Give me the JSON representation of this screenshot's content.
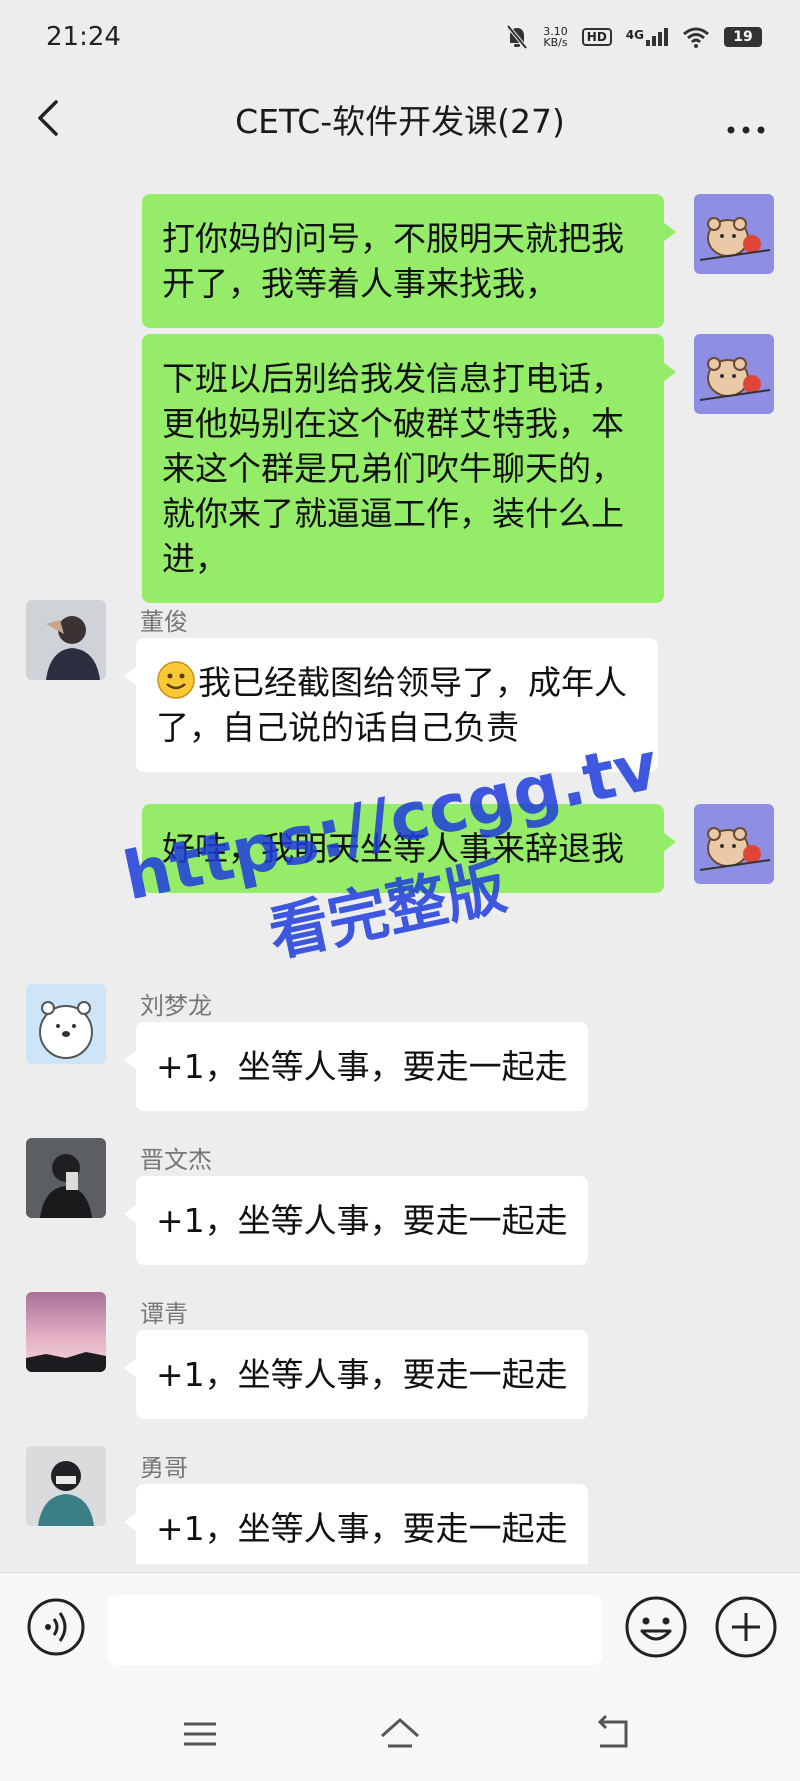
{
  "status_bar": {
    "time": "21:24",
    "net_speed_value": "3.10",
    "net_speed_unit": "KB/s",
    "hd_label": "HD",
    "network_label": "4G",
    "battery": "19"
  },
  "header": {
    "title": "CETC-软件开发课(27)"
  },
  "messages": [
    {
      "side": "right",
      "text": "打你妈的问号，不服明天就把我开了，我等着人事来找我，",
      "avatar": "bear-avatar"
    },
    {
      "side": "right",
      "text": "下班以后别给我发信息打电话，更他妈别在这个破群艾特我，本来这个群是兄弟们吹牛聊天的，就你来了就逼逼工作，装什么上进，",
      "avatar": "bear-avatar"
    },
    {
      "side": "left",
      "sender": "董俊",
      "text": "我已经截图给领导了，成年人了，自己说的话自己负责",
      "emoji": "smiley"
    },
    {
      "side": "right",
      "text": "好哇，我明天坐等人事来辞退我",
      "avatar": "bear-avatar"
    },
    {
      "side": "left",
      "sender": "刘梦龙",
      "text": "+1，坐等人事，要走一起走"
    },
    {
      "side": "left",
      "sender": "晋文杰",
      "text": "+1，坐等人事，要走一起走"
    },
    {
      "side": "left",
      "sender": "谭青",
      "text": "+1，坐等人事，要走一起走"
    },
    {
      "side": "left",
      "sender": "勇哥",
      "text": "+1，坐等人事，要走一起走"
    }
  ],
  "watermark": {
    "line1": "https://ccgg.tv",
    "line2": "看完整版"
  },
  "input_bar": {
    "placeholder": ""
  },
  "colors": {
    "background": "#ededed",
    "own_bubble": "#95ec69",
    "other_bubble": "#ffffff",
    "watermark": "#1e3cdc"
  }
}
